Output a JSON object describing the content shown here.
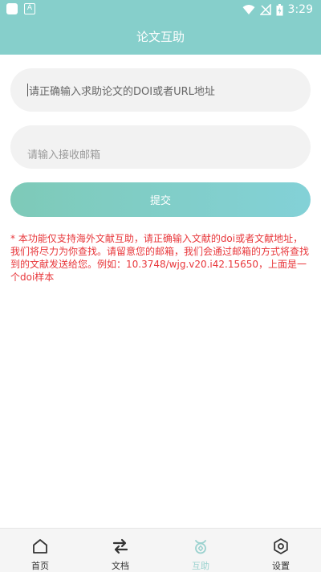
{
  "status_bar": {
    "time": "3:29"
  },
  "app_bar": {
    "title": "论文互助"
  },
  "form": {
    "doi_placeholder": "请正确输入求助论文的DOI或者URL地址",
    "email_placeholder": "请输入接收邮箱",
    "submit_label": "提交"
  },
  "notice": "* 本功能仅支持海外文献互助，请正确输入文献的doi或者文献地址，我们将尽力为你查找。请留意您的邮箱，我们会通过邮箱的方式将查找到的文献发送给您。例如：10.3748/wjg.v20.i42.15650，上面是一个doi样本",
  "tabs": [
    {
      "label": "首页",
      "icon": "home-icon"
    },
    {
      "label": "文档",
      "icon": "swap-icon"
    },
    {
      "label": "互助",
      "icon": "mutual-aid-icon",
      "active": true
    },
    {
      "label": "设置",
      "icon": "settings-icon"
    }
  ],
  "colors": {
    "header": "#86cfcb",
    "notice": "#e8373b",
    "active_tab": "#9bd2cf"
  }
}
